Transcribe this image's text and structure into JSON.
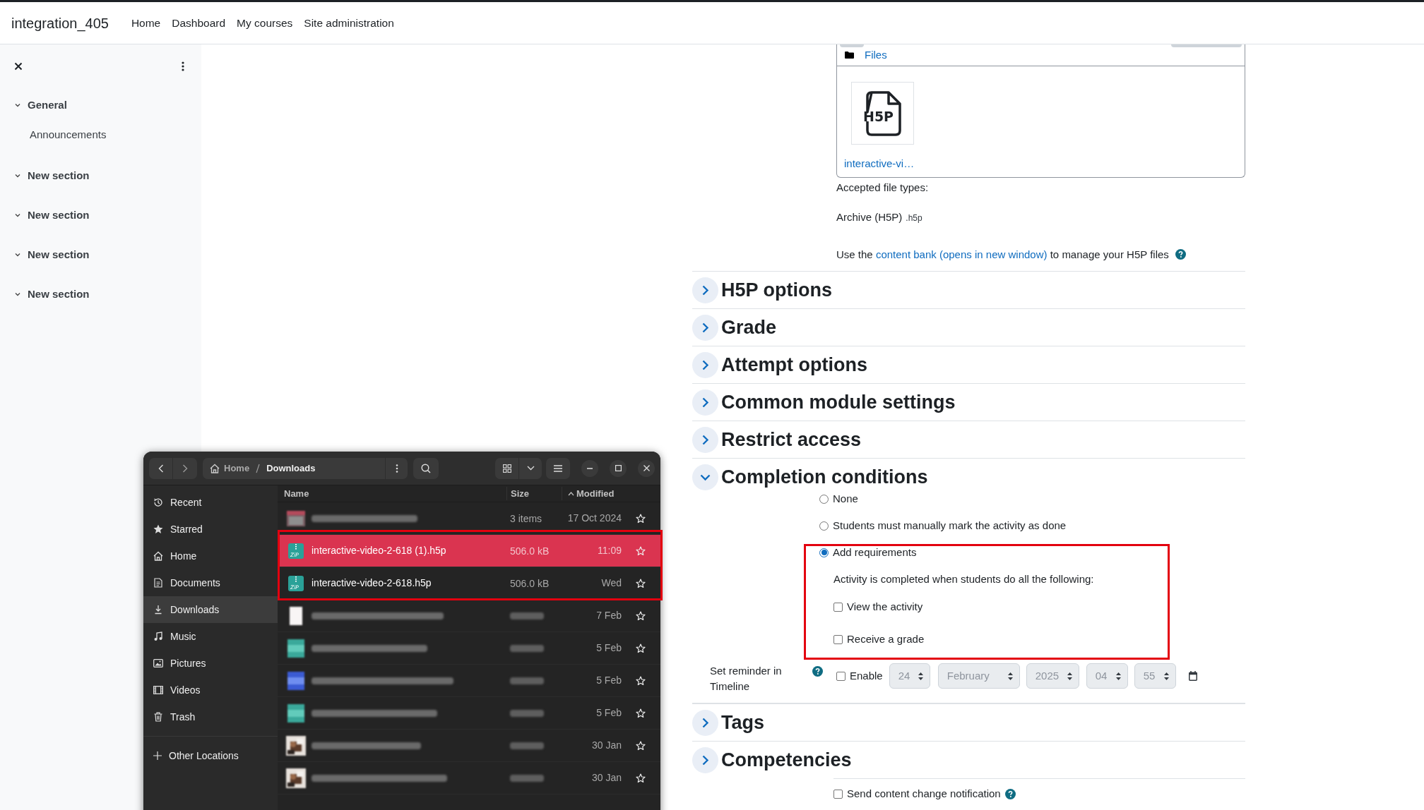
{
  "site": {
    "title": "integration_405",
    "nav": [
      "Home",
      "Dashboard",
      "My courses",
      "Site administration"
    ]
  },
  "course_index": {
    "sections": [
      {
        "title": "General",
        "expanded": true,
        "items": [
          "Announcements"
        ]
      },
      {
        "title": "New section",
        "expanded": true
      },
      {
        "title": "New section",
        "expanded": true
      },
      {
        "title": "New section",
        "expanded": true
      },
      {
        "title": "New section",
        "expanded": true
      }
    ]
  },
  "form": {
    "filepicker": {
      "folder": "Files",
      "file_name": "interactive-vi…",
      "thumbnail_text": "H5P"
    },
    "accepted_label": "Accepted file types:",
    "accepted_types": [
      {
        "name": "Archive (H5P)",
        "ext": ".h5p"
      }
    ],
    "content_bank_note": {
      "before": "Use the",
      "link": "content bank (opens in new window)",
      "after": "to manage your H5P files"
    },
    "sections": [
      {
        "title": "H5P options",
        "expanded": false
      },
      {
        "title": "Grade",
        "expanded": false
      },
      {
        "title": "Attempt options",
        "expanded": false
      },
      {
        "title": "Common module settings",
        "expanded": false
      },
      {
        "title": "Restrict access",
        "expanded": false
      },
      {
        "title": "Completion conditions",
        "expanded": true
      }
    ],
    "completion": {
      "options": [
        {
          "label": "None",
          "selected": false
        },
        {
          "label": "Students must manually mark the activity as done",
          "selected": false
        },
        {
          "label": "Add requirements",
          "selected": true
        }
      ],
      "requirements_intro": "Activity is completed when students do all the following:",
      "requirements": [
        {
          "label": "View the activity",
          "checked": false
        },
        {
          "label": "Receive a grade",
          "checked": false
        }
      ],
      "reminder": {
        "label": "Set reminder in Timeline",
        "enable_label": "Enable",
        "enabled": false,
        "fields": [
          "24",
          "February",
          "2025",
          "04",
          "55"
        ]
      }
    },
    "sections_after": [
      {
        "title": "Tags",
        "expanded": false
      },
      {
        "title": "Competencies",
        "expanded": false
      }
    ],
    "notification": {
      "label": "Send content change notification",
      "checked": false
    }
  },
  "file_manager": {
    "path": [
      "Home",
      "Downloads"
    ],
    "places": [
      {
        "label": "Recent",
        "selected": false
      },
      {
        "label": "Starred",
        "selected": false
      },
      {
        "label": "Home",
        "selected": false
      },
      {
        "label": "Documents",
        "selected": false
      },
      {
        "label": "Downloads",
        "selected": true
      },
      {
        "label": "Music",
        "selected": false
      },
      {
        "label": "Pictures",
        "selected": false
      },
      {
        "label": "Videos",
        "selected": false
      },
      {
        "label": "Trash",
        "selected": false
      }
    ],
    "other_locations": "Other Locations",
    "columns": [
      "Name",
      "Size",
      "Modified"
    ],
    "rows": [
      {
        "kind": "folder",
        "size": "3 items",
        "modified": "17 Oct 2024",
        "selected": false
      },
      {
        "kind": "zip",
        "icon_text": "ZiP",
        "name": "interactive-video-2-618 (1).h5p",
        "size": "506.0 kB",
        "modified": "11:09",
        "selected": true
      },
      {
        "kind": "zip",
        "icon_text": "ZiP",
        "name": "interactive-video-2-618.h5p",
        "size": "506.0 kB",
        "modified": "Wed",
        "selected": false
      },
      {
        "kind": "document",
        "modified": "7 Feb",
        "selected": false
      },
      {
        "kind": "teal",
        "modified": "5 Feb",
        "selected": false
      },
      {
        "kind": "blue",
        "modified": "5 Feb",
        "selected": false
      },
      {
        "kind": "teal",
        "modified": "5 Feb",
        "selected": false
      },
      {
        "modified": "30 Jan",
        "selected": false
      },
      {
        "modified": "30 Jan",
        "selected": false
      }
    ]
  }
}
